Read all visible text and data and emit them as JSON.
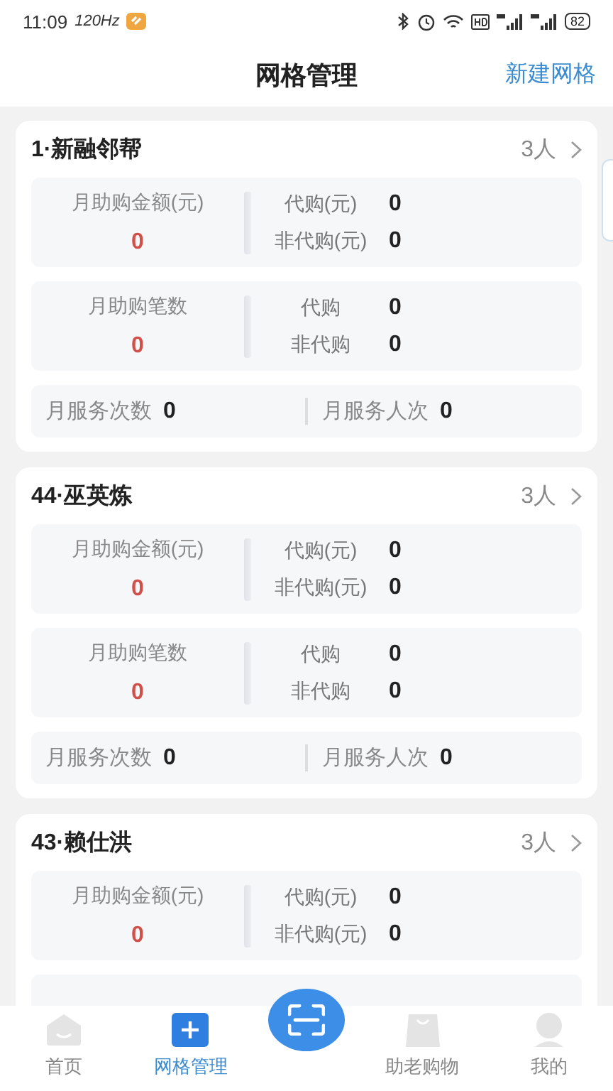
{
  "status_bar": {
    "time": "11:09",
    "refresh_rate": "120Hz",
    "battery": "82"
  },
  "header": {
    "title": "网格管理",
    "action": "新建网格"
  },
  "groups": [
    {
      "title": "1·新融邻帮",
      "members": "3人",
      "amount": {
        "label": "月助购金额(元)",
        "value": "0",
        "rows": [
          {
            "label": "代购(元)",
            "value": "0"
          },
          {
            "label": "非代购(元)",
            "value": "0"
          }
        ]
      },
      "count": {
        "label": "月助购笔数",
        "value": "0",
        "rows": [
          {
            "label": "代购",
            "value": "0"
          },
          {
            "label": "非代购",
            "value": "0"
          }
        ]
      },
      "services": [
        {
          "label": "月服务次数",
          "value": "0"
        },
        {
          "label": "月服务人次",
          "value": "0"
        }
      ]
    },
    {
      "title": "44·巫英炼",
      "members": "3人",
      "amount": {
        "label": "月助购金额(元)",
        "value": "0",
        "rows": [
          {
            "label": "代购(元)",
            "value": "0"
          },
          {
            "label": "非代购(元)",
            "value": "0"
          }
        ]
      },
      "count": {
        "label": "月助购笔数",
        "value": "0",
        "rows": [
          {
            "label": "代购",
            "value": "0"
          },
          {
            "label": "非代购",
            "value": "0"
          }
        ]
      },
      "services": [
        {
          "label": "月服务次数",
          "value": "0"
        },
        {
          "label": "月服务人次",
          "value": "0"
        }
      ]
    },
    {
      "title": "43·赖仕洪",
      "members": "3人",
      "amount": {
        "label": "月助购金额(元)",
        "value": "0",
        "rows": [
          {
            "label": "代购(元)",
            "value": "0"
          },
          {
            "label": "非代购(元)",
            "value": "0"
          }
        ]
      }
    }
  ],
  "tab_bar": [
    {
      "kind": "home",
      "label": "首页",
      "selected": false
    },
    {
      "kind": "grid",
      "label": "网格管理",
      "selected": true
    },
    {
      "kind": "scan"
    },
    {
      "kind": "bag",
      "label": "助老购物",
      "selected": false
    },
    {
      "kind": "user",
      "label": "我的",
      "selected": false
    }
  ]
}
